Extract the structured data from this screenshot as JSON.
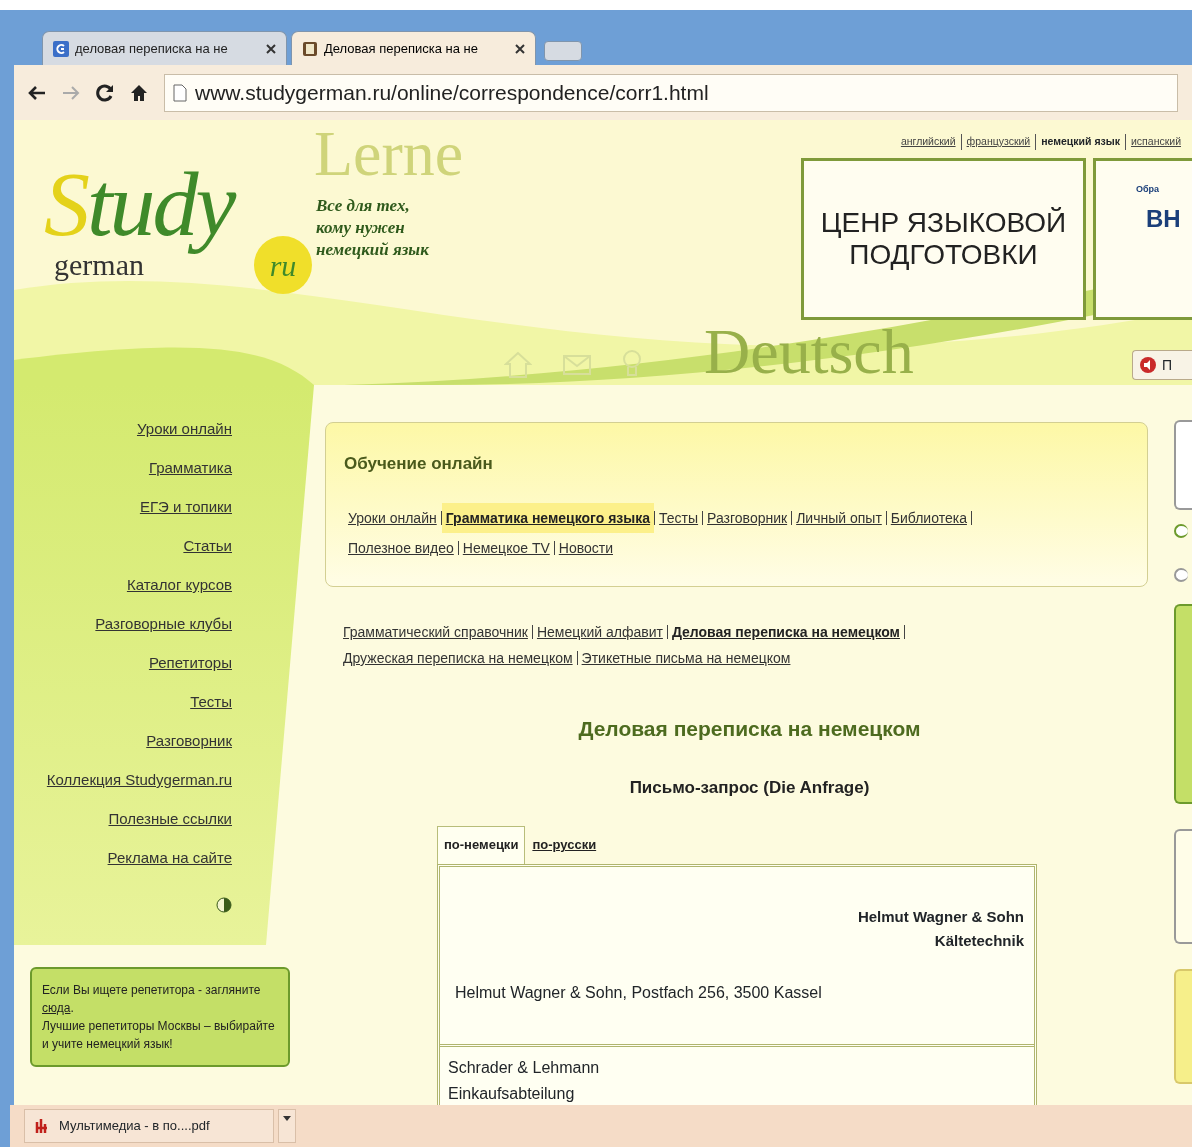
{
  "browser": {
    "tabs": [
      {
        "title": "деловая переписка на не",
        "selected": false
      },
      {
        "title": "Деловая переписка на не",
        "selected": true
      }
    ],
    "forward_disabled": true,
    "address": "www.studygerman.ru/online/correspondence/corr1.html"
  },
  "languages": [
    {
      "label": "английский",
      "current": false
    },
    {
      "label": "французский",
      "current": false
    },
    {
      "label": "немецкий язык",
      "current": true
    },
    {
      "label": "испанский",
      "current": false
    }
  ],
  "logo": {
    "word": "Study",
    "sub": "german",
    "badge": "ru"
  },
  "tagline": "Все для тех,\nкому нужен\nнемецкий язык",
  "watermarks": [
    "Lerne",
    "Deutsch"
  ],
  "banner": {
    "text": "ЦЕНР ЯЗЫКОВОЙ ПОДГОТОВКИ"
  },
  "banner_2": {
    "caption": "Обра",
    "title": "ВН"
  },
  "side_button": {
    "label": "П"
  },
  "sidebar": {
    "items": [
      "Уроки онлайн",
      "Грамматика",
      "ЕГЭ и топики",
      "Статьи",
      "Каталог курсов",
      "Разговорные клубы",
      "Репетиторы",
      "Тесты",
      "Разговорник",
      "Коллекция Studygerman.ru",
      "Полезные ссылки",
      "Реклама на сайте"
    ]
  },
  "tip": {
    "before": "Если Вы ищете репетитора - загляните ",
    "link": "сюда",
    "after": ".",
    "line2": "Лучшие репетиторы Москвы – выбирайте и учите немецкий язык!"
  },
  "section": {
    "title": "Обучение онлайн",
    "links": [
      {
        "label": "Уроки онлайн",
        "selected": false
      },
      {
        "label": "Грамматика немецкого языка",
        "selected": true
      },
      {
        "label": "Тесты",
        "selected": false
      },
      {
        "label": "Разговорник",
        "selected": false
      },
      {
        "label": "Личный опыт",
        "selected": false
      },
      {
        "label": "Библиотека",
        "selected": false
      },
      {
        "label": "Полезное видео",
        "selected": false
      },
      {
        "label": "Немецкое TV",
        "selected": false
      },
      {
        "label": "Новости",
        "selected": false
      }
    ]
  },
  "subnav": [
    {
      "label": "Грамматический справочник",
      "selected": false
    },
    {
      "label": "Немецкий алфавит",
      "selected": false
    },
    {
      "label": "Деловая переписка на немецком",
      "selected": true
    },
    {
      "label": "Дружеская переписка на немецком",
      "selected": false
    },
    {
      "label": "Этикетные письма на немецком",
      "selected": false
    }
  ],
  "page_title": "Деловая переписка на немецком",
  "letter_title": "Письмо-запрос (Die Anfrage)",
  "letter_tabs": [
    {
      "label": "по-немецки",
      "selected": true
    },
    {
      "label": "по-русски",
      "selected": false
    }
  ],
  "letter": {
    "sender_lines": [
      "Helmut Wagner & Sohn",
      "Kältetechnik"
    ],
    "return_address": "Helmut Wagner & Sohn, Postfach 256, 3500 Kassel",
    "recipient_lines": [
      "Schrader & Lehmann",
      "Einkaufsabteilung"
    ]
  },
  "download": {
    "file": "Мультимедиа - в по....pdf"
  }
}
